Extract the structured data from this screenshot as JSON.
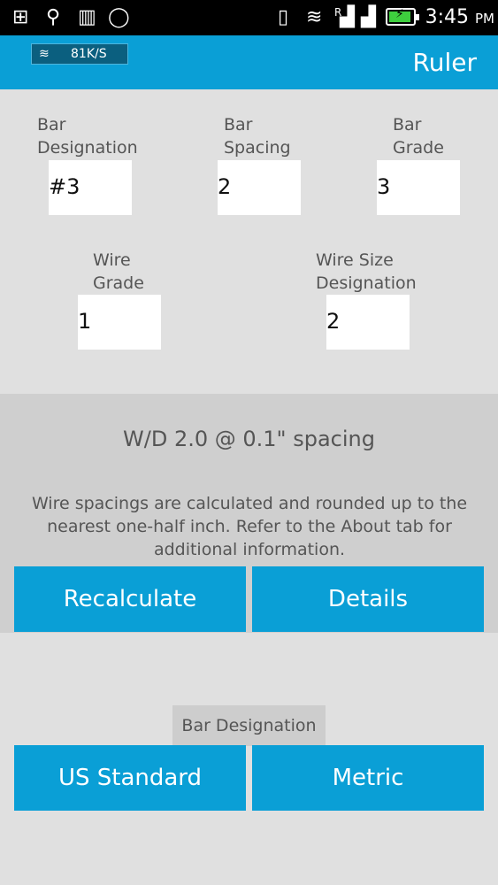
{
  "status_bar": {
    "time": "3:45",
    "ampm": "PM",
    "signal_label": "R"
  },
  "app_bar": {
    "network_speed": "81K/S",
    "title": "Ruler"
  },
  "form": {
    "bar_designation": {
      "label_line1": "Bar",
      "label_line2": "Designation",
      "value": "#3"
    },
    "bar_spacing": {
      "label_line1": "Bar",
      "label_line2": "Spacing",
      "value": "2"
    },
    "bar_grade": {
      "label_line1": "Bar",
      "label_line2": "Grade",
      "value": "3"
    },
    "wire_grade": {
      "label_line1": "Wire",
      "label_line2": "Grade",
      "value": "1"
    },
    "wire_size_designation": {
      "label_line1": "Wire Size",
      "label_line2": "Designation",
      "value": "2"
    }
  },
  "result": {
    "title": "W/D 2.0 @ 0.1\" spacing",
    "note": "Wire spacings are calculated and rounded up to the nearest one-half inch. Refer to the About tab for additional information."
  },
  "actions": {
    "recalculate_label": "Recalculate",
    "details_label": "Details"
  },
  "units": {
    "section_label": "Bar Designation",
    "us_standard_label": "US Standard",
    "metric_label": "Metric"
  }
}
